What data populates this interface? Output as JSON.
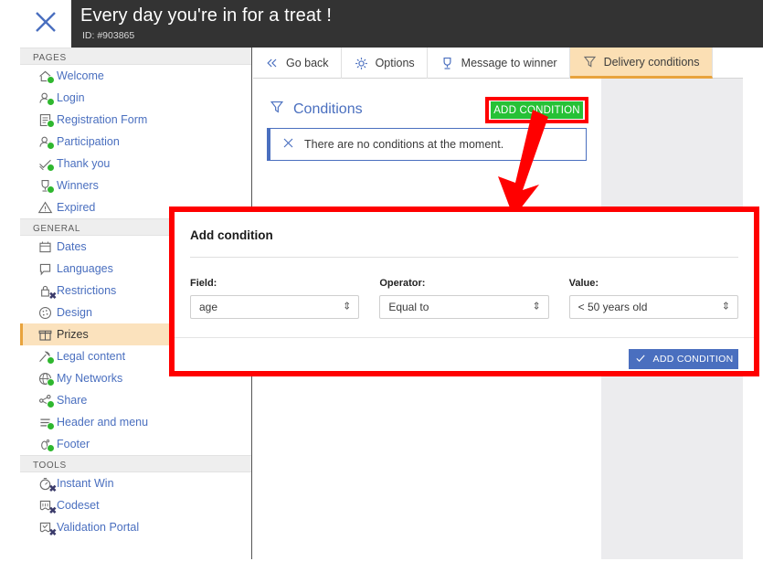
{
  "header": {
    "close_icon": "close-x-icon",
    "title": "Every day you're in for a treat !",
    "id": "ID: #903865"
  },
  "sidebar": {
    "sections": [
      {
        "label": "PAGES",
        "items": [
          {
            "label": "Welcome",
            "icon": "home-icon",
            "badge": "green-dot"
          },
          {
            "label": "Login",
            "icon": "user-key-icon",
            "badge": "green-dot"
          },
          {
            "label": "Registration Form",
            "icon": "form-icon",
            "badge": "green-dot"
          },
          {
            "label": "Participation",
            "icon": "user-edit-icon",
            "badge": "green-dot"
          },
          {
            "label": "Thank you",
            "icon": "check-ribbon-icon",
            "badge": "green-dot"
          },
          {
            "label": "Winners",
            "icon": "trophy-icon",
            "badge": "green-dot"
          },
          {
            "label": "Expired",
            "icon": "warning-triangle-icon",
            "badge": "none"
          }
        ]
      },
      {
        "label": "GENERAL",
        "items": [
          {
            "label": "Dates",
            "icon": "calendar-icon",
            "badge": "none"
          },
          {
            "label": "Languages",
            "icon": "speech-bubble-icon",
            "badge": "none"
          },
          {
            "label": "Restrictions",
            "icon": "lock-icon",
            "badge": "x-mark"
          },
          {
            "label": "Design",
            "icon": "palette-icon",
            "badge": "none"
          },
          {
            "label": "Prizes",
            "icon": "gift-icon",
            "badge": "none",
            "active": true
          },
          {
            "label": "Legal content",
            "icon": "gavel-icon",
            "badge": "green-dot"
          },
          {
            "label": "My Networks",
            "icon": "network-globe-icon",
            "badge": "green-dot"
          },
          {
            "label": "Share",
            "icon": "share-icon",
            "badge": "green-dot"
          },
          {
            "label": "Header and menu",
            "icon": "menu-lines-icon",
            "badge": "green-dot"
          },
          {
            "label": "Footer",
            "icon": "footprint-icon",
            "badge": "green-dot"
          }
        ]
      },
      {
        "label": "TOOLS",
        "items": [
          {
            "label": "Instant Win",
            "icon": "stopwatch-icon",
            "badge": "x-mark"
          },
          {
            "label": "Codeset",
            "icon": "ticket-icon",
            "badge": "x-mark"
          },
          {
            "label": "Validation Portal",
            "icon": "ticket-check-icon",
            "badge": "x-mark"
          }
        ]
      }
    ]
  },
  "tabs": [
    {
      "label": "Go back",
      "icon": "double-chevron-left-icon",
      "active": false
    },
    {
      "label": "Options",
      "icon": "gear-icon",
      "active": false
    },
    {
      "label": "Message to winner",
      "icon": "trophy-icon",
      "active": false
    },
    {
      "label": "Delivery conditions",
      "icon": "filter-funnel-icon",
      "active": true
    }
  ],
  "conditions": {
    "title": "Conditions",
    "title_icon": "filter-funnel-icon",
    "add_button": "ADD CONDITION",
    "empty_icon": "close-x-icon",
    "empty_text": "There are no conditions at the moment."
  },
  "dialog": {
    "title": "Add condition",
    "fields": [
      {
        "label": "Field:",
        "value": "age"
      },
      {
        "label": "Operator:",
        "value": "Equal to"
      },
      {
        "label": "Value:",
        "value": "< 50 years old"
      }
    ],
    "submit_label": "ADD CONDITION",
    "submit_icon": "check-icon"
  },
  "annotations": {
    "highlight_color": "#ff0000",
    "arrow_icon": "red-arrow-down-icon"
  },
  "colors": {
    "accent_orange": "#e8a33d",
    "link_blue": "#4a6fbf",
    "green_button": "#26c136",
    "header_dark": "#333333"
  }
}
